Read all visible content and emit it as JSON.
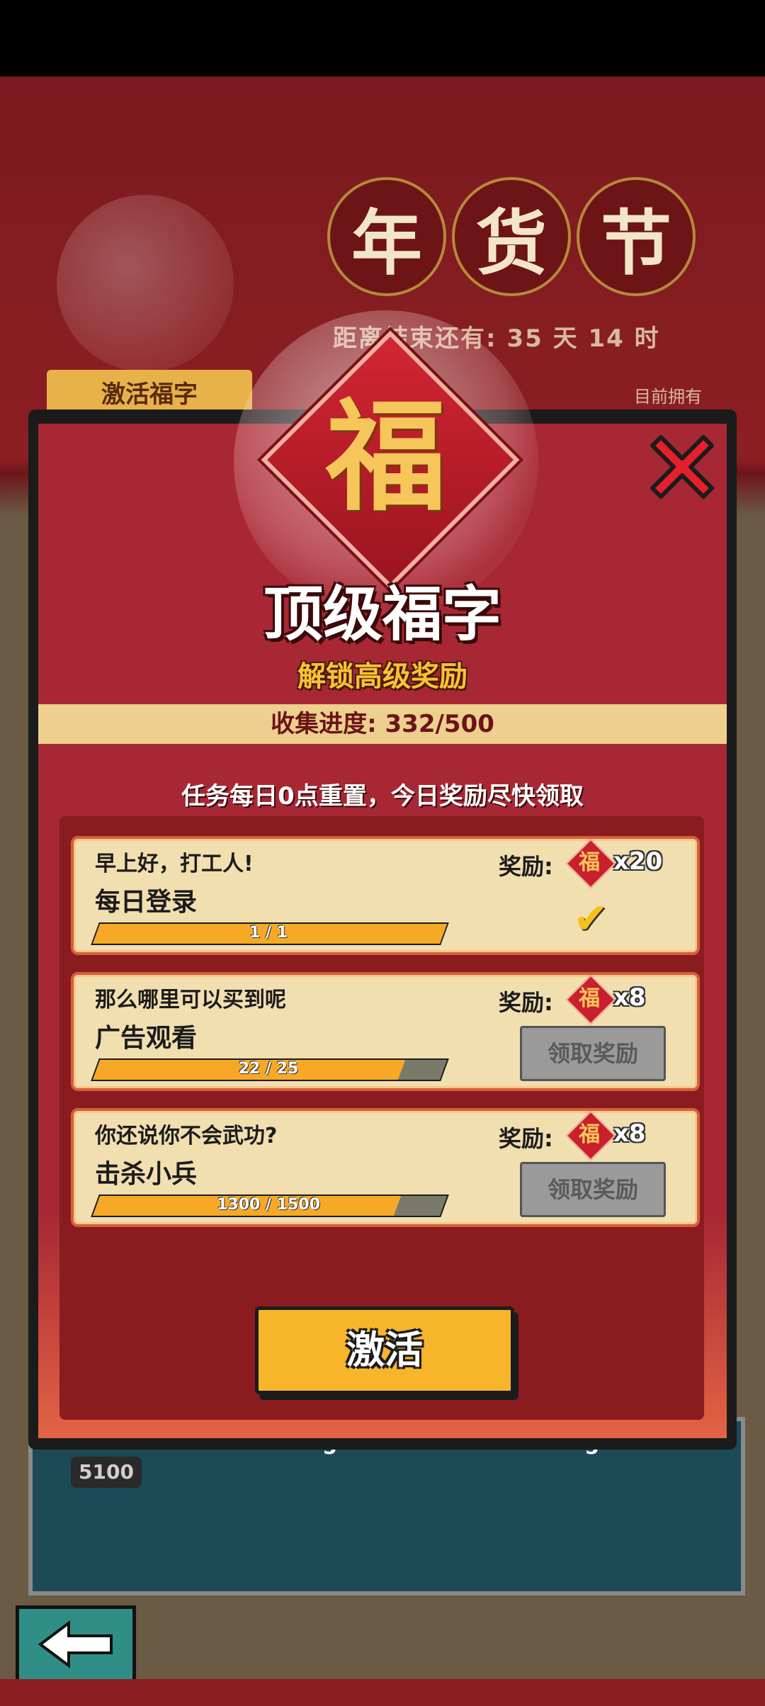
{
  "background": {
    "festival_chars": [
      "年",
      "货",
      "节"
    ],
    "timer_label": "距离结束还有:",
    "timer_value": "35 天 14 时",
    "tab_label": "激活福字",
    "owned_label": "目前拥有",
    "track_value": "5100",
    "track_counts": [
      "5",
      "5"
    ]
  },
  "panel": {
    "fu_char": "福",
    "title": "顶级福字",
    "subtitle": "解锁高级奖励",
    "progress_text": "收集进度: 332/500",
    "notice": "任务每日0点重置，今日奖励尽快领取",
    "activate_label": "激活",
    "tasks": [
      {
        "desc": "早上好，打工人!",
        "name": "每日登录",
        "progress_text": "1 / 1",
        "progress": 1.0,
        "reward_label": "奖励:",
        "reward_char": "福",
        "reward_count": "x20",
        "status": "done",
        "claim_label": ""
      },
      {
        "desc": "那么哪里可以买到呢",
        "name": "广告观看",
        "progress_text": "22 / 25",
        "progress": 0.88,
        "reward_label": "奖励:",
        "reward_char": "福",
        "reward_count": "x8",
        "status": "pending",
        "claim_label": "领取奖励"
      },
      {
        "desc": "你还说你不会武功?",
        "name": "击杀小兵",
        "progress_text": "1300 / 1500",
        "progress": 0.867,
        "reward_label": "奖励:",
        "reward_char": "福",
        "reward_count": "x8",
        "status": "pending",
        "claim_label": "领取奖励"
      }
    ]
  },
  "colors": {
    "panel_red": "#a72834",
    "gold": "#f8c233",
    "bar_fill": "#f7a826"
  },
  "icons": {
    "close": "close-icon",
    "back": "back-arrow-icon",
    "check": "checkmark-icon"
  }
}
